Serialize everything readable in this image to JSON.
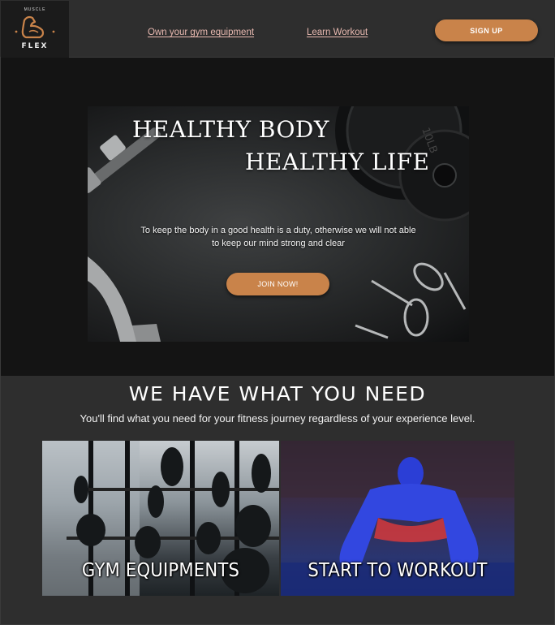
{
  "brand": {
    "logo_top": "MUSCLE",
    "logo_name": "FLEX",
    "accent": "#c9834a"
  },
  "nav": {
    "links": [
      "Own your gym equipment",
      "Learn Workout"
    ],
    "signup_label": "SIGN UP"
  },
  "hero": {
    "line1": "HEALTHY BODY",
    "line2": "HEALTHY LIFE",
    "text_line1": "To keep the body in a good health is a duty, otherwise we will not able",
    "text_line2": "to keep our mind strong and clear",
    "cta_label": "JOIN NOW!"
  },
  "section": {
    "title": "WE HAVE WHAT YOU NEED",
    "subtitle": "You'll find what you need for your fitness journey regardless of your experience level.",
    "cards": [
      {
        "label": "GYM EQUIPMENTS"
      },
      {
        "label": "START TO WORKOUT"
      }
    ]
  }
}
